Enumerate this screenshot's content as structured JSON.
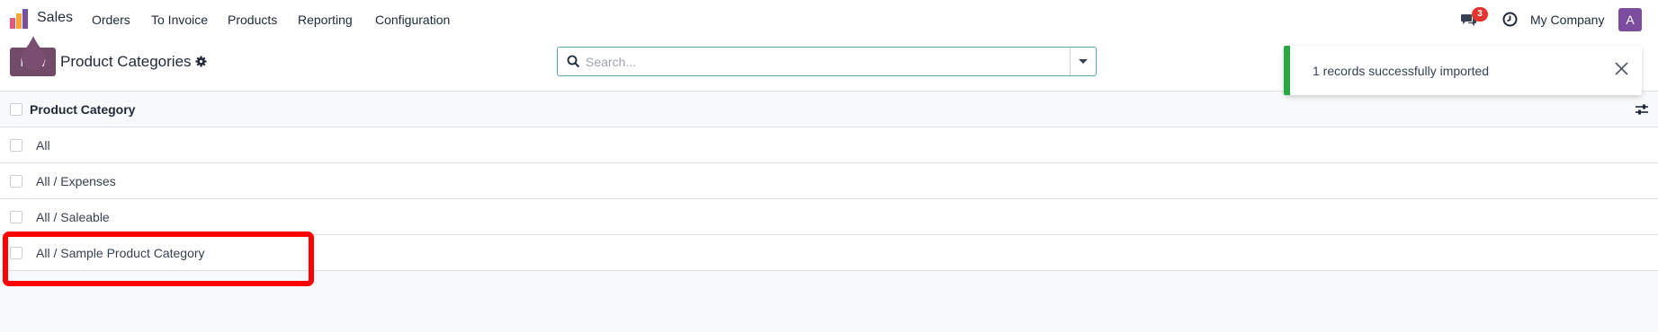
{
  "navbar": {
    "app_name": "Sales",
    "menu": [
      "Orders",
      "To Invoice",
      "Products",
      "Reporting",
      "Configuration"
    ],
    "chat_badge": "3",
    "company": "My Company",
    "avatar_letter": "A"
  },
  "control_panel": {
    "new_label": "New",
    "breadcrumb": "Product Categories",
    "search_placeholder": "Search..."
  },
  "toast": {
    "message": "1 records successfully imported",
    "accent_color": "#28a745"
  },
  "list": {
    "column_header": "Product Category",
    "rows": [
      "All",
      "All / Expenses",
      "All / Saleable",
      "All / Sample Product Category"
    ]
  },
  "colors": {
    "brand": "#714b67",
    "highlight": "#ff0000"
  }
}
